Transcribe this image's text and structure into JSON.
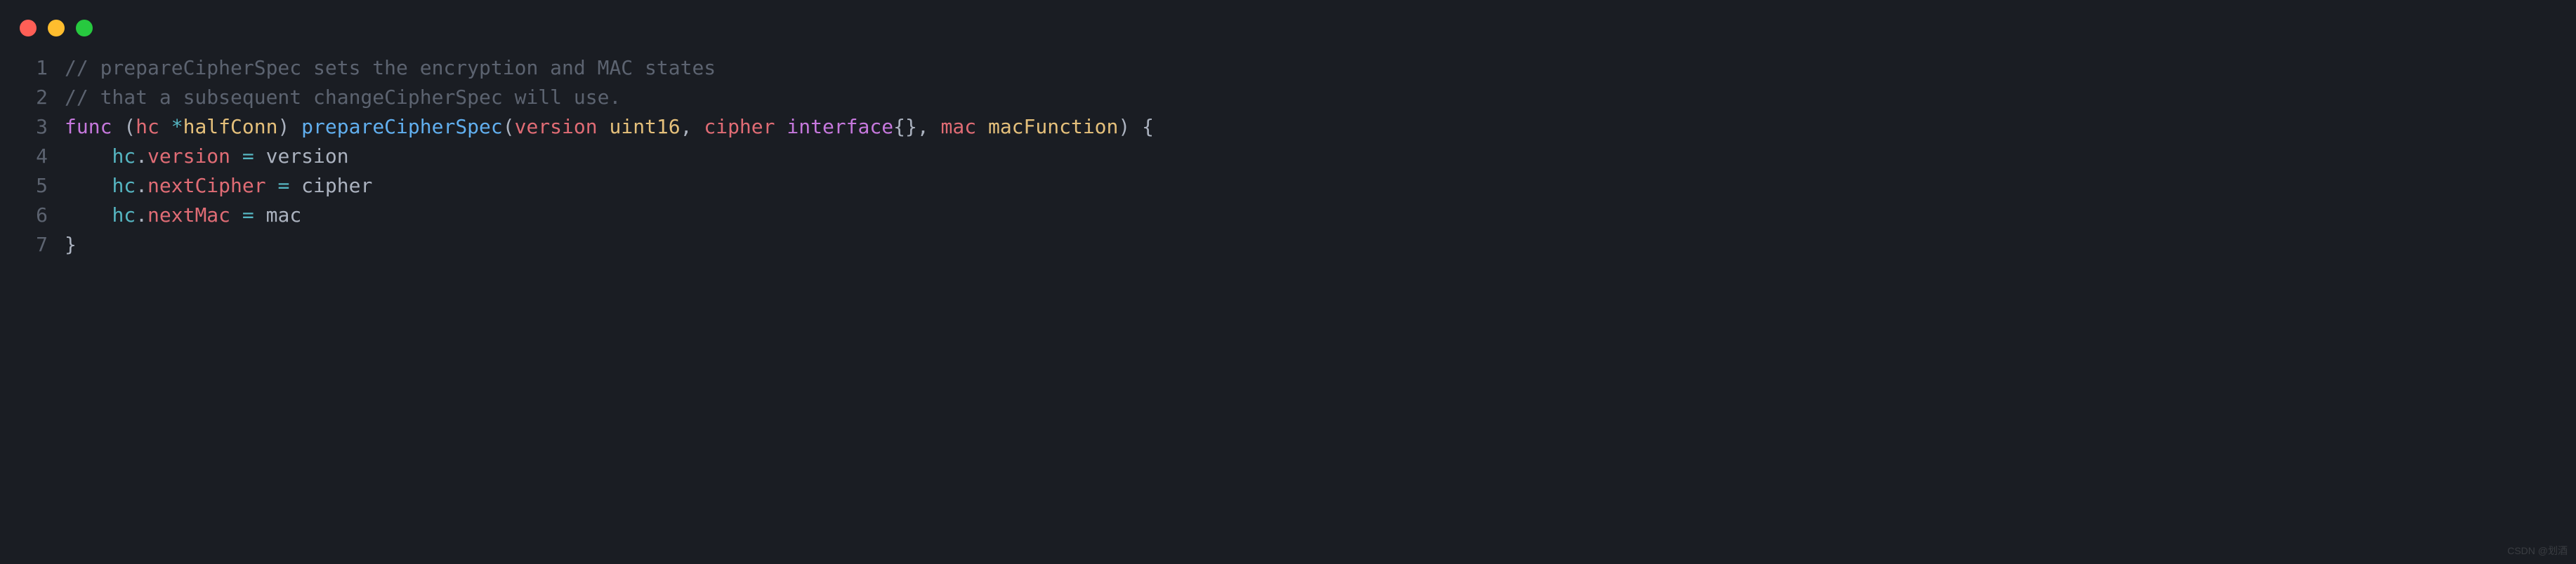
{
  "window": {
    "controls": {
      "close": "close",
      "minimize": "minimize",
      "maximize": "maximize"
    }
  },
  "code": {
    "lines": {
      "1": {
        "number": "1",
        "comment": "// prepareCipherSpec sets the encryption and MAC states"
      },
      "2": {
        "number": "2",
        "comment": "// that a subsequent changeCipherSpec will use."
      },
      "3": {
        "number": "3",
        "func": "func",
        "lparen1": " (",
        "receiver": "hc",
        "star": " *",
        "receiverType": "halfConn",
        "rparen1": ") ",
        "funcName": "prepareCipherSpec",
        "lparen2": "(",
        "param1": "version",
        "space1": " ",
        "type1": "uint16",
        "comma1": ", ",
        "param2": "cipher",
        "space2": " ",
        "interface": "interface",
        "braces": "{}",
        "comma2": ", ",
        "param3": "mac",
        "space3": " ",
        "type3": "macFunction",
        "rparen2": ") {"
      },
      "4": {
        "number": "4",
        "indent": "    ",
        "obj": "hc",
        "dot": ".",
        "prop": "version",
        "eq": " = ",
        "val": "version"
      },
      "5": {
        "number": "5",
        "indent": "    ",
        "obj": "hc",
        "dot": ".",
        "prop": "nextCipher",
        "eq": " = ",
        "val": "cipher"
      },
      "6": {
        "number": "6",
        "indent": "    ",
        "obj": "hc",
        "dot": ".",
        "prop": "nextMac",
        "eq": " = ",
        "val": "mac"
      },
      "7": {
        "number": "7",
        "brace": "}"
      }
    }
  },
  "watermark": "CSDN @划酒"
}
